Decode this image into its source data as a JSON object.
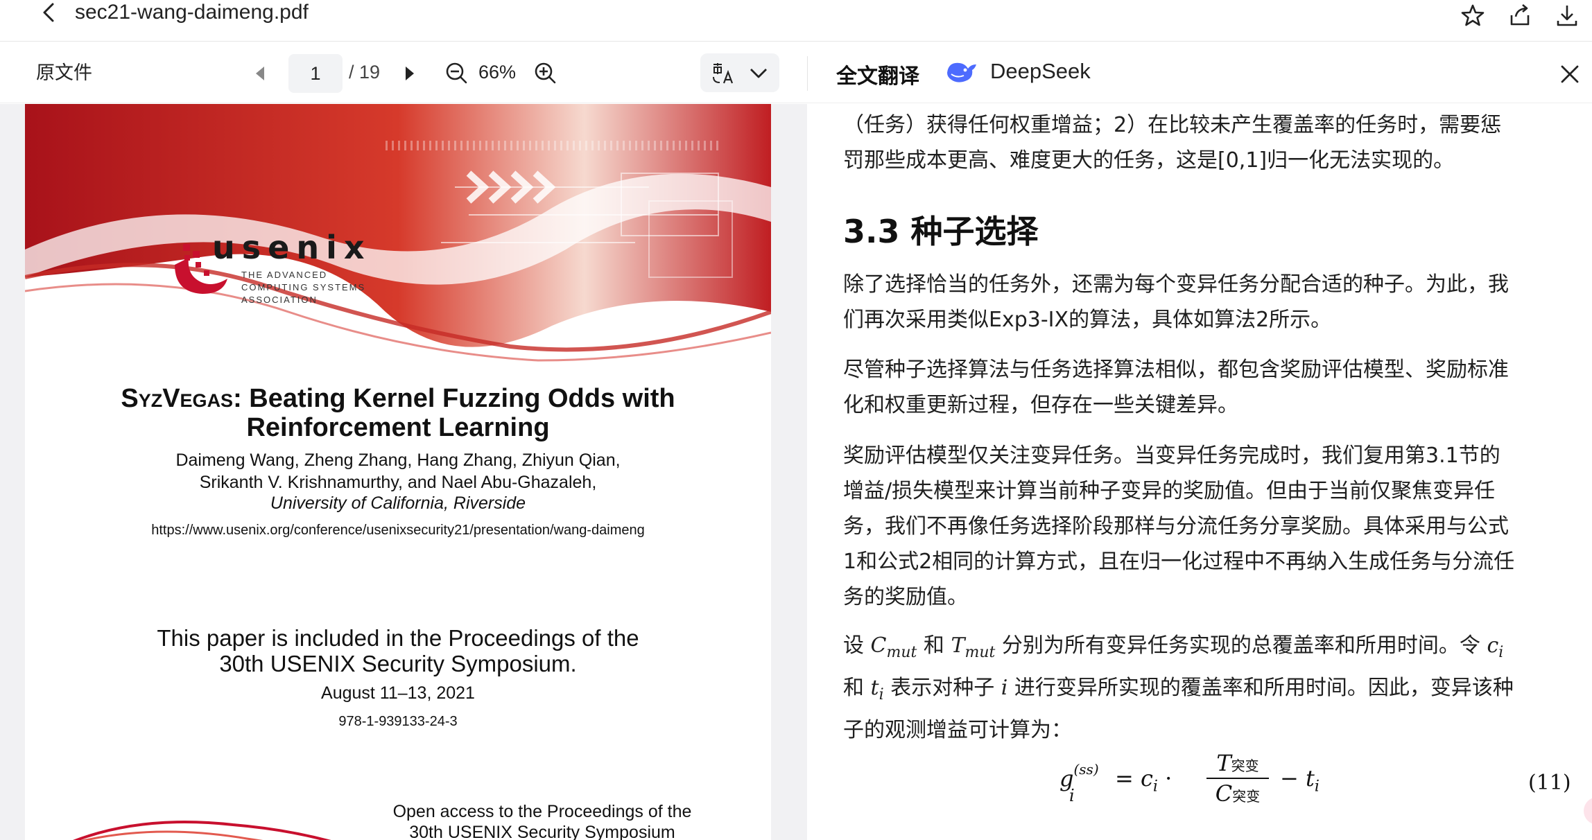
{
  "titlebar": {
    "filename": "sec21-wang-daimeng.pdf",
    "icons": [
      "back-arrow-icon",
      "star-icon",
      "share-icon",
      "download-icon"
    ]
  },
  "toolbar": {
    "original_label": "原文件",
    "page_current": "1",
    "page_total": "/ 19",
    "zoom": "66%",
    "translate_title": "全文翻译",
    "engine": "DeepSeek",
    "icons": [
      "prev-page-icon",
      "next-page-icon",
      "zoom-out-icon",
      "zoom-in-icon",
      "translate-lang-icon",
      "chevron-down-icon",
      "deepseek-logo-icon",
      "close-icon"
    ]
  },
  "pdf": {
    "org_name": "usenix",
    "org_sub": "THE ADVANCED COMPUTING SYSTEMS ASSOCIATION",
    "title_sc": "SyzVegas",
    "title_rest": ": Beating Kernel Fuzzing Odds with",
    "title_line2": "Reinforcement Learning",
    "authors_line1": "Daimeng Wang, Zheng Zhang, Hang Zhang, Zhiyun Qian,",
    "authors_line2": "Srikanth V. Krishnamurthy, and Nael Abu-Ghazaleh,",
    "affiliation": "University of California, Riverside",
    "url": "https://www.usenix.org/conference/usenixsecurity21/presentation/wang-daimeng",
    "proc_line1": "This paper is included in the Proceedings of the",
    "proc_line2": "30th USENIX Security Symposium.",
    "date": "August 11–13, 2021",
    "isbn": "978-1-939133-24-3",
    "open_access_line1": "Open access to the Proceedings of the",
    "open_access_line2": "30th USENIX Security Symposium"
  },
  "translation": {
    "p0_line1": "（任务）获得任何权重增益；2）在比较未产生覆盖率的任务时，需要惩",
    "p0_line2": "罚那些成本更高、难度更大的任务，这是[0,1]归一化无法实现的。",
    "heading": "3.3 种子选择",
    "p1_line1": "除了选择恰当的任务外，还需为每个变异任务分配合适的种子。为此，我",
    "p1_line2": "们再次采用类似Exp3-IX的算法，具体如算法2所示。",
    "p2_line1": "尽管种子选择算法与任务选择算法相似，都包含奖励评估模型、奖励标准",
    "p2_line2": "化和权重更新过程，但存在一些关键差异。",
    "p3_line1": "奖励评估模型仅关注变异任务。当变异任务完成时，我们复用第3.1节的",
    "p3_line2": "增益/损失模型来计算当前种子变异的奖励值。但由于当前仅聚焦变异任",
    "p3_line3": "务，我们不再像任务选择阶段那样与分流任务分享奖励。具体采用与公式",
    "p3_line4": "1和公式2相同的计算方式，且在归一化过程中不再纳入生成任务与分流任",
    "p3_line5": "务的奖励值。",
    "p4_a": "设 ",
    "p4_cmut": "C",
    "p4_mut": "mut",
    "p4_b": " 和 ",
    "p4_tmut": "T",
    "p4_c": " 分别为所有变异任务实现的总覆盖率和所用时间。令 ",
    "p4_ci": "c",
    "p4_i": "i",
    "p4_line2a": "和 ",
    "p4_ti": "t",
    "p4_line2b": " 表示对种子 ",
    "p4_seed": "i",
    "p4_line2c": " 进行变异所实现的覆盖率和所用时间。因此，变异该种",
    "p4_line3": "子的观测增益可计算为：",
    "formula_g": "g",
    "formula_sup": "(ss)",
    "formula_eq": "= c",
    "formula_dot": "·",
    "formula_T": "T",
    "formula_tsub": "突变",
    "formula_C": "C",
    "formula_csub": "突变",
    "formula_minus": "− t",
    "eq_number": "(11)"
  }
}
